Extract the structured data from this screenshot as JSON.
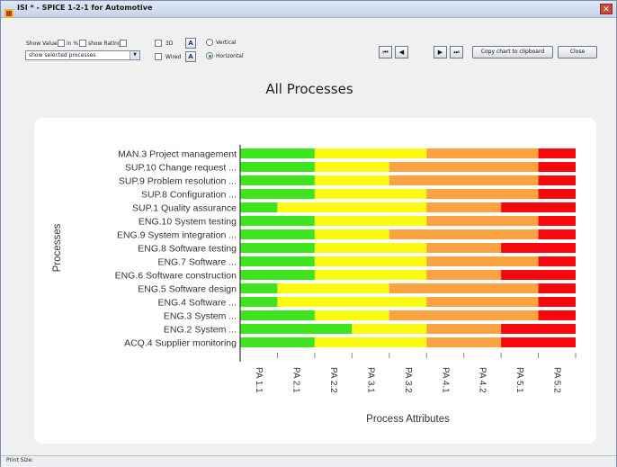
{
  "window": {
    "title": "ISI * - SPICE 1-2-1 for Automotive",
    "close_symbol": "✕"
  },
  "toolbar": {
    "show_values_label": "Show Values",
    "in_pct_label": "in %",
    "show_rating_label": "show Rating",
    "three_d_label": "3D",
    "wired_label": "Wired",
    "vertical_label": "Vertical",
    "horizontal_label": "Horizontal",
    "process_filter": "show selected processes",
    "orientation_selected": "Horizontal",
    "align_top_glyph": "A",
    "align_bottom_glyph": "A"
  },
  "nav": {
    "first": "⏮",
    "prev": "◀",
    "next": "▶",
    "last": "⏭",
    "copy_label": "Copy chart to clipboard",
    "close_label": "Close"
  },
  "status": {
    "text": "Print Size:"
  },
  "colors": {
    "green": "#3ee41e",
    "yellow": "#fbfb12",
    "orange": "#fba340",
    "red": "#f5090f",
    "axis": "#333333",
    "text": "#333333"
  },
  "chart_data": {
    "type": "bar",
    "orientation": "horizontal",
    "stacked": true,
    "title": "All Processes",
    "xlabel": "Process Attributes",
    "ylabel": "Processes",
    "x_ticks": [
      "PA 1.1",
      "PA 2.1",
      "PA 2.2",
      "PA 3.1",
      "PA 3.2",
      "PA 4.1",
      "PA 4.2",
      "PA 5.1",
      "PA 5.2"
    ],
    "xlim": [
      0,
      9
    ],
    "categories": [
      "MAN.3 Project management",
      "SUP.10 Change request ...",
      "SUP.9 Problem resolution ...",
      "SUP.8 Configuration ...",
      "SUP.1 Quality assurance",
      "ENG.10 System testing",
      "ENG.9 System integration ...",
      "ENG.8 Software testing",
      "ENG.7 Software ...",
      "ENG.6 Software construction",
      "ENG.5 Software design",
      "ENG.4 Software ...",
      "ENG.3 System ...",
      "ENG.2 System ...",
      "ACQ.4 Supplier monitoring"
    ],
    "series": [
      {
        "rating": "green",
        "values": [
          2.0,
          2.0,
          2.0,
          2.0,
          1.0,
          2.0,
          2.0,
          2.0,
          2.0,
          2.0,
          1.0,
          1.0,
          2.0,
          3.0,
          2.0
        ]
      },
      {
        "rating": "yellow",
        "values": [
          3.0,
          2.0,
          2.0,
          3.0,
          4.0,
          3.0,
          2.0,
          3.0,
          3.0,
          3.0,
          3.0,
          4.0,
          2.0,
          2.0,
          3.0
        ]
      },
      {
        "rating": "orange",
        "values": [
          3.0,
          4.0,
          4.0,
          3.0,
          2.0,
          3.0,
          4.0,
          2.0,
          3.0,
          2.0,
          4.0,
          3.0,
          4.0,
          2.0,
          2.0
        ]
      },
      {
        "rating": "red",
        "values": [
          1.0,
          1.0,
          1.0,
          1.0,
          2.0,
          1.0,
          1.0,
          2.0,
          1.0,
          2.0,
          1.0,
          1.0,
          1.0,
          2.0,
          2.0
        ]
      }
    ],
    "legend": "none",
    "grid": false
  }
}
